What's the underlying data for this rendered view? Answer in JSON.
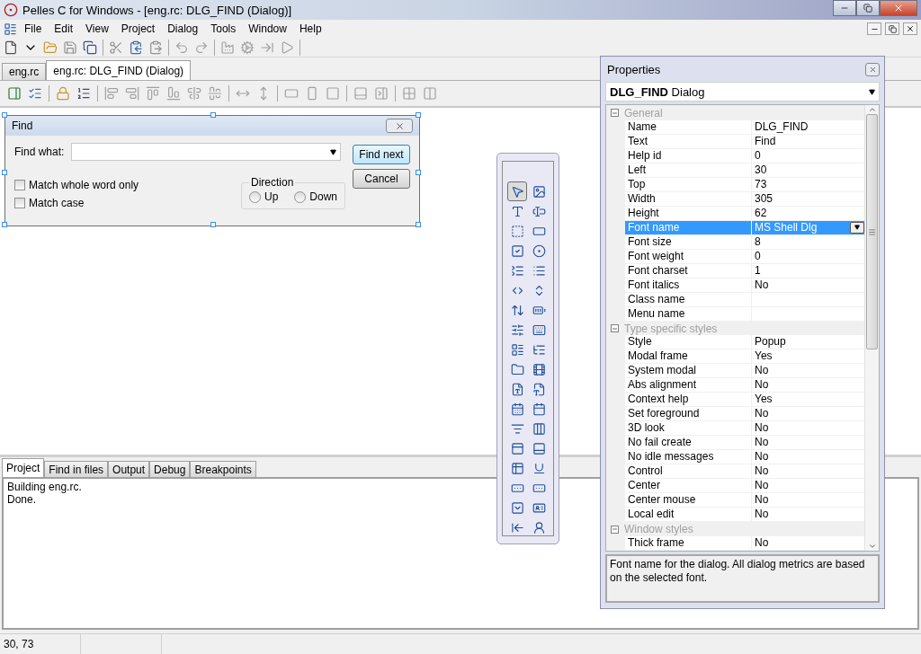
{
  "window": {
    "title": "Pelles C for Windows - [eng.rc: DLG_FIND (Dialog)]"
  },
  "menu": [
    "File",
    "Edit",
    "View",
    "Project",
    "Dialog",
    "Tools",
    "Window",
    "Help"
  ],
  "doc_tabs": [
    {
      "label": "eng.rc",
      "selected": false
    },
    {
      "label": "eng.rc: DLG_FIND (Dialog)",
      "selected": true
    }
  ],
  "find_dialog": {
    "title": "Find",
    "find_label": "Find what:",
    "buttons": [
      {
        "label": "Find next",
        "default": true
      },
      {
        "label": "Cancel",
        "default": false
      }
    ],
    "checkboxes": [
      {
        "label": "Match whole word only",
        "checked": false
      },
      {
        "label": "Match case",
        "checked": false
      }
    ],
    "direction": {
      "title": "Direction",
      "options": [
        {
          "label": "Up",
          "selected": false
        },
        {
          "label": "Down",
          "selected": false
        }
      ]
    }
  },
  "toolbox": {
    "tools": [
      {
        "selected": true
      },
      {
        "selected": false
      },
      {
        "selected": false
      },
      {
        "selected": false
      },
      {
        "selected": false
      },
      {
        "selected": false
      },
      {
        "selected": false
      },
      {
        "selected": false
      },
      {
        "selected": false
      },
      {
        "selected": false
      },
      {
        "selected": false
      },
      {
        "selected": false
      },
      {
        "selected": false
      },
      {
        "selected": false
      },
      {
        "selected": false
      },
      {
        "selected": false
      },
      {
        "selected": false
      },
      {
        "selected": false
      },
      {
        "selected": false
      },
      {
        "selected": false
      },
      {
        "selected": false
      },
      {
        "selected": false
      },
      {
        "selected": false
      },
      {
        "selected": false
      },
      {
        "selected": false
      },
      {
        "selected": false
      },
      {
        "selected": false
      },
      {
        "selected": false
      },
      {
        "selected": false
      },
      {
        "selected": false
      },
      {
        "selected": false
      },
      {
        "selected": false
      },
      {
        "selected": false
      },
      {
        "selected": false
      },
      {
        "selected": false
      },
      {
        "selected": false
      }
    ]
  },
  "properties": {
    "title": "Properties",
    "object": "**DLG_FIND** Dialog",
    "groups": [
      {
        "name": "General",
        "expanded": true,
        "rows": [
          {
            "name": "Name",
            "value": "DLG_FIND",
            "selected": false
          },
          {
            "name": "Text",
            "value": "Find",
            "selected": false
          },
          {
            "name": "Help id",
            "value": "0",
            "selected": false
          },
          {
            "name": "Left",
            "value": "30",
            "selected": false
          },
          {
            "name": "Top",
            "value": "73",
            "selected": false
          },
          {
            "name": "Width",
            "value": "305",
            "selected": false
          },
          {
            "name": "Height",
            "value": "62",
            "selected": false
          },
          {
            "name": "Font name",
            "value": "MS Shell Dlg",
            "selected": true
          },
          {
            "name": "Font size",
            "value": "8",
            "selected": false
          },
          {
            "name": "Font weight",
            "value": "0",
            "selected": false
          },
          {
            "name": "Font charset",
            "value": "1",
            "selected": false
          },
          {
            "name": "Font italics",
            "value": "No",
            "selected": false
          },
          {
            "name": "Class name",
            "selected": false
          },
          {
            "name": "Menu name",
            "selected": false
          }
        ]
      },
      {
        "name": "Type specific styles",
        "expanded": true,
        "rows": [
          {
            "name": "Style",
            "value": "Popup",
            "selected": false
          },
          {
            "name": "Modal frame",
            "value": "Yes",
            "selected": false
          },
          {
            "name": "System modal",
            "value": "No",
            "selected": false
          },
          {
            "name": "Abs alignment",
            "value": "No",
            "selected": false
          },
          {
            "name": "Context help",
            "value": "Yes",
            "selected": false
          },
          {
            "name": "Set foreground",
            "value": "No",
            "selected": false
          },
          {
            "name": "3D look",
            "value": "No",
            "selected": false
          },
          {
            "name": "No fail create",
            "value": "No",
            "selected": false
          },
          {
            "name": "No idle messages",
            "value": "No",
            "selected": false
          },
          {
            "name": "Control",
            "value": "No",
            "selected": false
          },
          {
            "name": "Center",
            "value": "No",
            "selected": false
          },
          {
            "name": "Center mouse",
            "value": "No",
            "selected": false
          },
          {
            "name": "Local edit",
            "value": "No",
            "selected": false
          }
        ]
      },
      {
        "name": "Window styles",
        "expanded": true,
        "rows": [
          {
            "name": "Thick frame",
            "value": "No",
            "selected": false
          }
        ]
      }
    ],
    "description": "Font name for the dialog. All dialog metrics are based on the selected font."
  },
  "output_tabs": [
    {
      "label": "Project",
      "selected": true
    },
    {
      "label": "Find in files",
      "selected": false
    },
    {
      "label": "Output",
      "selected": false
    },
    {
      "label": "Debug",
      "selected": false
    },
    {
      "label": "Breakpoints",
      "selected": false
    }
  ],
  "output_lines": [
    "Building eng.rc.",
    "Done."
  ],
  "status_bar": {
    "position": "30, 73"
  }
}
